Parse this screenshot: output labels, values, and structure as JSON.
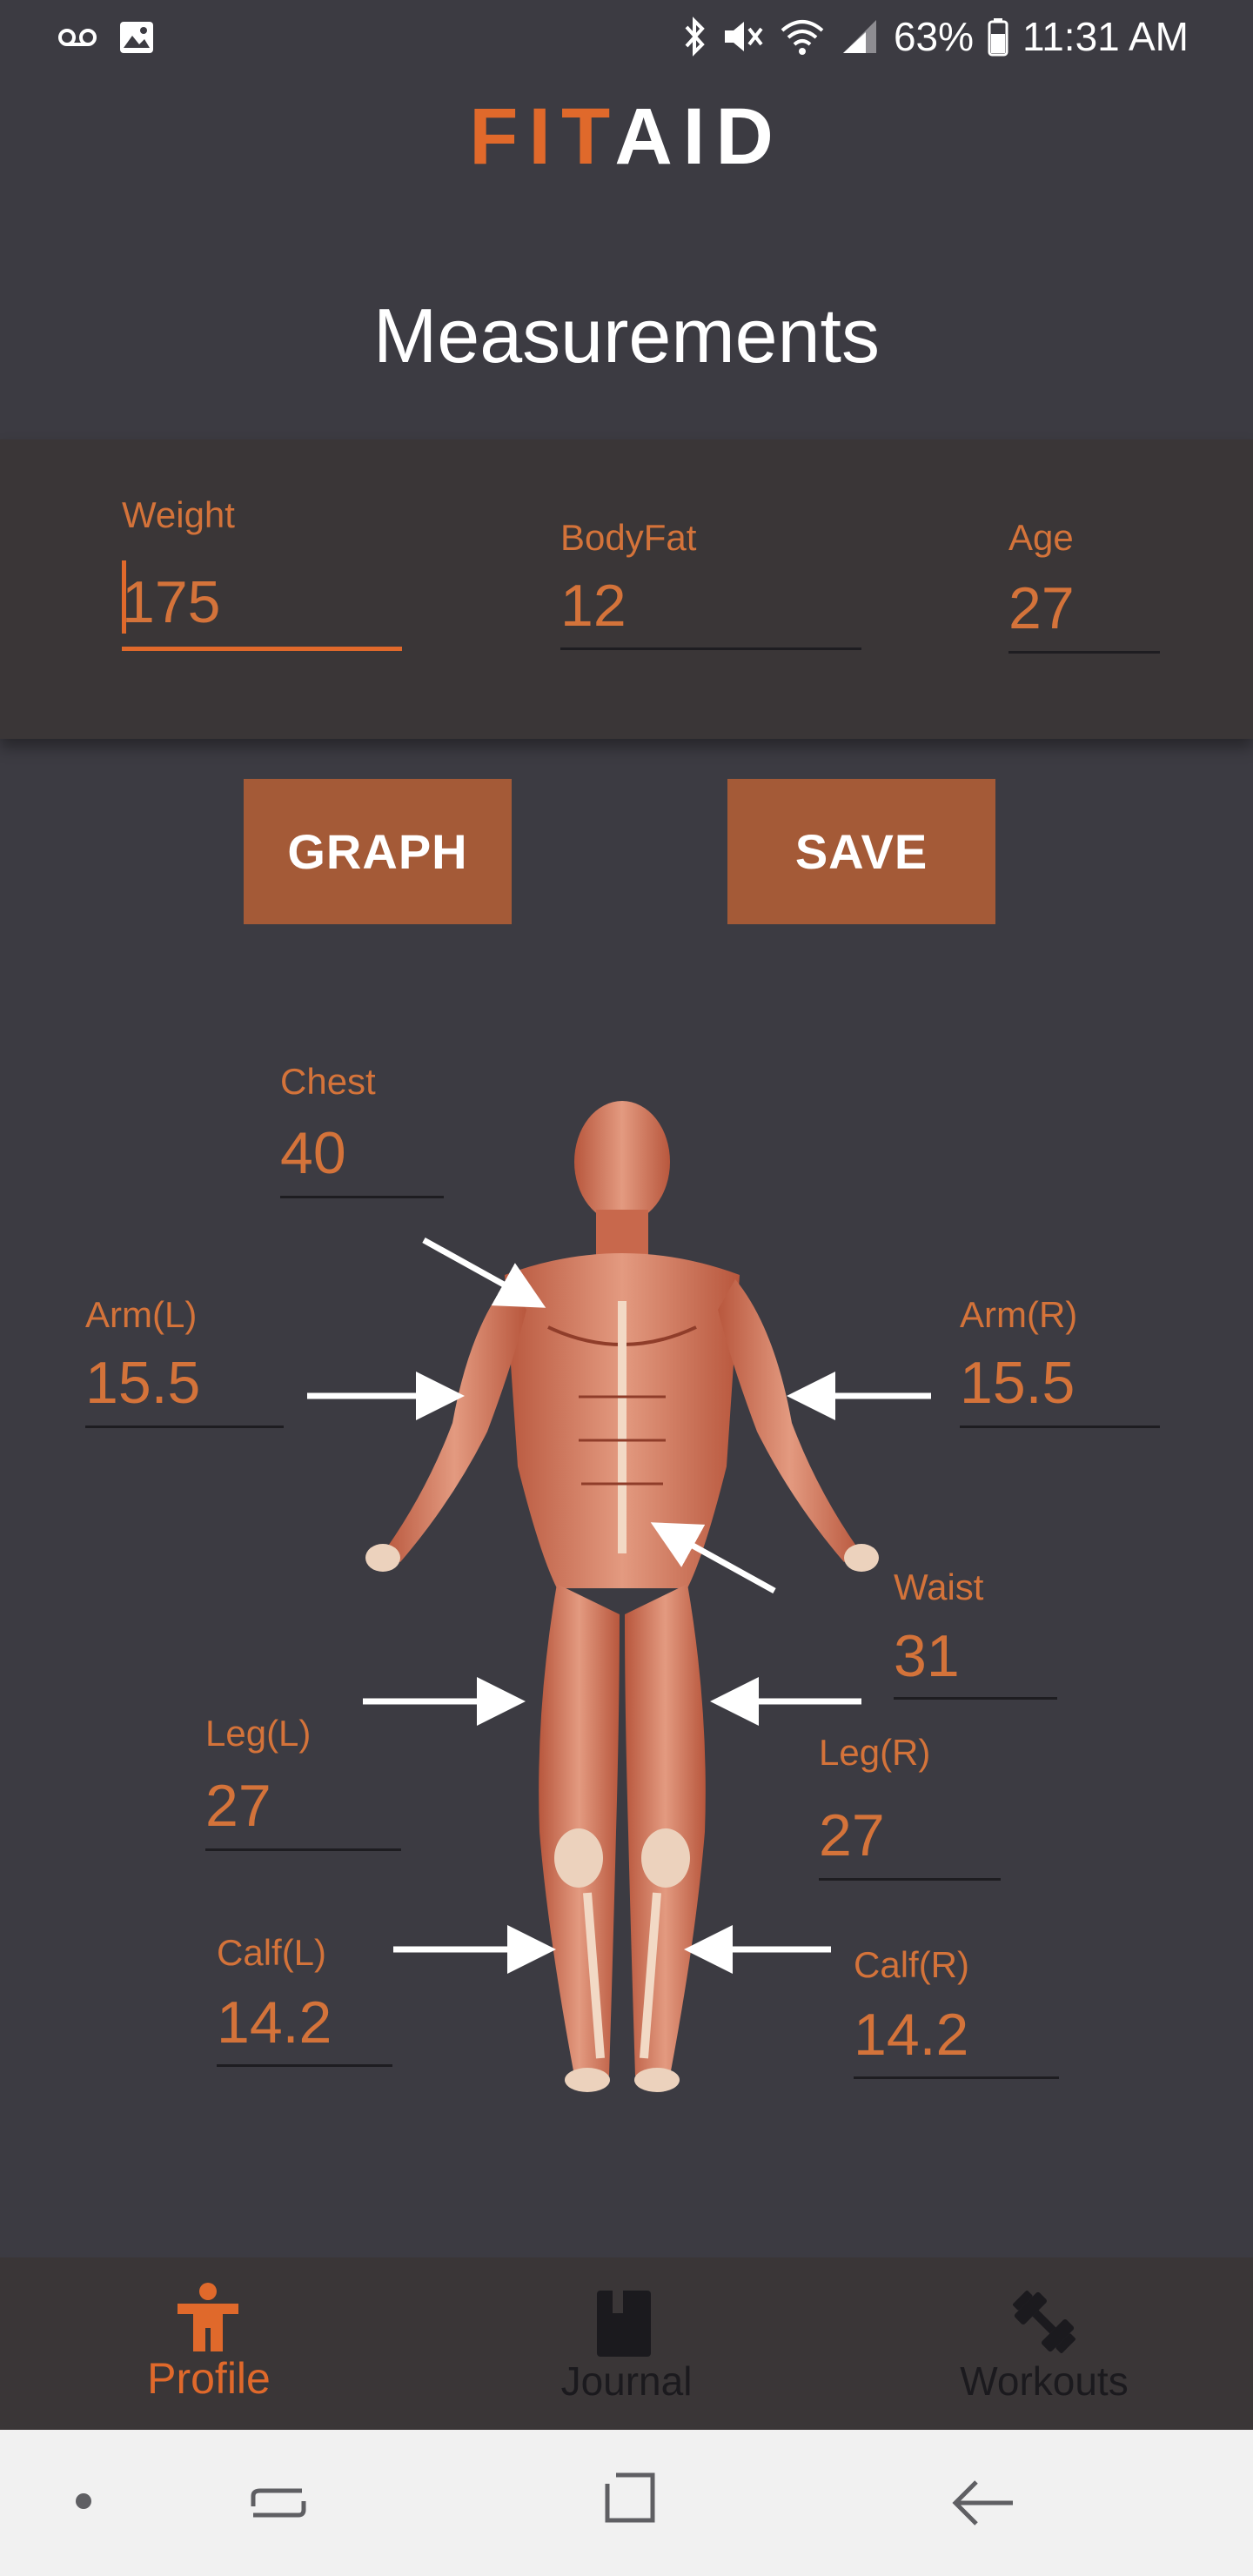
{
  "status_bar": {
    "battery": "63%",
    "time": "11:31 AM"
  },
  "logo": {
    "part1": "FIT",
    "part2": "AID"
  },
  "page_title": "Measurements",
  "top_fields": {
    "weight": {
      "label": "Weight",
      "value": "175"
    },
    "bodyfat": {
      "label": "BodyFat",
      "value": "12"
    },
    "age": {
      "label": "Age",
      "value": "27"
    }
  },
  "buttons": {
    "graph": "GRAPH",
    "save": "SAVE"
  },
  "measurements": {
    "chest": {
      "label": "Chest",
      "value": "40"
    },
    "arm_l": {
      "label": "Arm(L)",
      "value": "15.5"
    },
    "arm_r": {
      "label": "Arm(R)",
      "value": "15.5"
    },
    "waist": {
      "label": "Waist",
      "value": "31"
    },
    "leg_l": {
      "label": "Leg(L)",
      "value": "27"
    },
    "leg_r": {
      "label": "Leg(R)",
      "value": "27"
    },
    "calf_l": {
      "label": "Calf(L)",
      "value": "14.2"
    },
    "calf_r": {
      "label": "Calf(R)",
      "value": "14.2"
    }
  },
  "bottom_nav": {
    "items": [
      {
        "label": "Profile",
        "icon": "person-icon",
        "active": true
      },
      {
        "label": "Journal",
        "icon": "book-icon",
        "active": false
      },
      {
        "label": "Workouts",
        "icon": "dumbbell-icon",
        "active": false
      }
    ]
  },
  "colors": {
    "accent": "#e0692b",
    "button": "#a45a37",
    "background": "#3c3b42",
    "card": "#3a3637",
    "label": "#d4733a"
  }
}
